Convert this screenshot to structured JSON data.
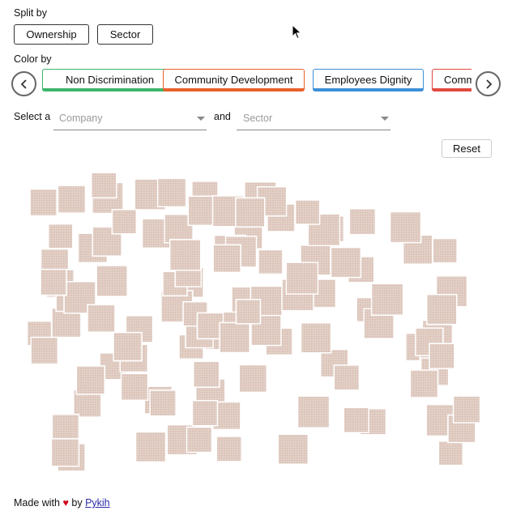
{
  "split_by": {
    "label": "Split by",
    "buttons": [
      "Ownership",
      "Sector"
    ]
  },
  "color_by": {
    "label": "Color by",
    "chips": [
      {
        "label": "Non Discrimination",
        "color": "#3db56a"
      },
      {
        "label": "Community Development",
        "color": "#e8612c"
      },
      {
        "label": "Employees Dignity",
        "color": "#3d8fd6"
      },
      {
        "label": "Comm",
        "color": "#e04a3f"
      }
    ],
    "prev_icon": "chevron-left-icon",
    "next_icon": "chevron-right-icon"
  },
  "filters": {
    "select_label": "Select a",
    "and_label": "and",
    "company_placeholder": "Company",
    "sector_placeholder": "Sector"
  },
  "reset_label": "Reset",
  "squares": {
    "fill_color": "#e3d0c7",
    "texture_color": "#d6bcb0",
    "count": 110
  },
  "footer": {
    "made_with": "Made with",
    "by": "by",
    "link_text": "Pykih"
  }
}
